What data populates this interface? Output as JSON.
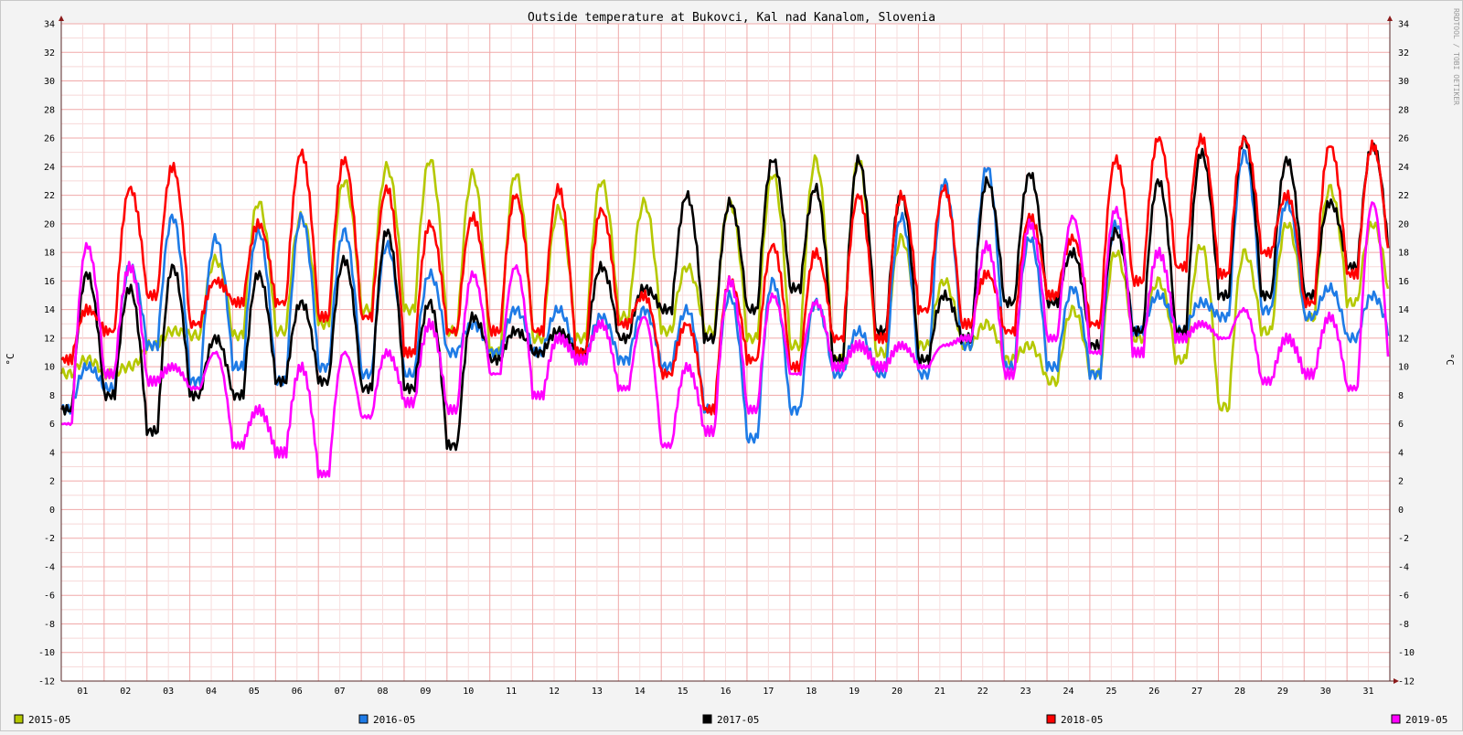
{
  "chart_data": {
    "type": "line",
    "title": "Outside temperature at Bukovci, Kal nad Kanalom, Slovenia",
    "ylabel": "°C",
    "ylabel_right": "°C",
    "watermark": "RRDTOOL / TOBI OETIKER",
    "ylim": [
      -12,
      34
    ],
    "y_ticks": [
      34,
      32,
      30,
      28,
      26,
      24,
      22,
      20,
      18,
      16,
      14,
      12,
      10,
      8,
      6,
      4,
      2,
      0,
      -2,
      -4,
      -6,
      -8,
      -10,
      -12
    ],
    "xlim": [
      1,
      32
    ],
    "x_ticks": [
      "01",
      "02",
      "03",
      "04",
      "05",
      "06",
      "07",
      "08",
      "09",
      "10",
      "11",
      "12",
      "13",
      "14",
      "15",
      "16",
      "17",
      "18",
      "19",
      "20",
      "21",
      "22",
      "23",
      "24",
      "25",
      "26",
      "27",
      "28",
      "29",
      "30",
      "31"
    ],
    "grid": true,
    "legend_position": "bottom",
    "series": [
      {
        "name": "2015-05",
        "color": "#b5c800",
        "min": [
          9.5,
          9.5,
          11.5,
          12.2,
          12.2,
          12.5,
          13.0,
          14.0,
          14.0,
          12.5,
          11.0,
          12.0,
          12.0,
          13.5,
          12.5,
          12.5,
          12.0,
          11.5,
          10.5,
          11.0,
          11.5,
          11.5,
          10.5,
          9.0,
          9.5,
          12.0,
          10.5,
          7.2,
          12.5,
          13.5,
          14.5
        ],
        "max": [
          10.5,
          10.0,
          12.5,
          17.5,
          21.5,
          20.5,
          23.0,
          24.0,
          24.5,
          23.5,
          23.5,
          21.0,
          23.0,
          21.5,
          17.0,
          21.5,
          23.5,
          24.5,
          24.5,
          19.0,
          16.0,
          13.0,
          11.5,
          14.0,
          18.0,
          16.0,
          18.5,
          18.0,
          20.0,
          22.5,
          20.0
        ]
      },
      {
        "name": "2016-05",
        "color": "#1e7be6",
        "min": [
          7.0,
          8.5,
          11.5,
          9.0,
          10.0,
          9.0,
          10.0,
          9.5,
          9.5,
          11.0,
          11.0,
          11.0,
          10.5,
          10.5,
          10.0,
          7.0,
          5.0,
          7.0,
          9.5,
          9.5,
          9.5,
          11.5,
          10.0,
          10.0,
          9.5,
          12.5,
          12.5,
          13.5,
          14.0,
          13.5,
          12.0
        ],
        "max": [
          10.0,
          17.0,
          20.5,
          19.0,
          19.5,
          20.5,
          19.5,
          18.5,
          16.5,
          13.0,
          14.0,
          14.0,
          13.5,
          14.0,
          14.0,
          15.0,
          16.0,
          14.5,
          12.5,
          20.5,
          23.0,
          24.0,
          19.0,
          15.5,
          20.0,
          15.0,
          14.5,
          25.0,
          21.5,
          15.5,
          15.0
        ]
      },
      {
        "name": "2017-05",
        "color": "#000000",
        "min": [
          7.0,
          8.0,
          5.5,
          8.0,
          8.0,
          9.0,
          9.0,
          8.5,
          8.5,
          4.5,
          10.5,
          11.0,
          11.0,
          12.0,
          14.0,
          12.0,
          14.0,
          15.5,
          10.5,
          12.5,
          10.5,
          12.0,
          14.5,
          14.5,
          11.5,
          12.5,
          12.5,
          15.0,
          15.0,
          15.0,
          17.0
        ],
        "max": [
          16.5,
          15.5,
          17.0,
          12.0,
          16.5,
          14.5,
          17.5,
          19.5,
          14.5,
          13.5,
          12.5,
          12.5,
          17.0,
          15.5,
          22.0,
          21.5,
          24.5,
          22.5,
          24.5,
          22.0,
          15.0,
          23.0,
          23.5,
          18.0,
          19.5,
          23.0,
          25.0,
          26.0,
          24.5,
          21.5,
          25.5
        ]
      },
      {
        "name": "2018-05",
        "color": "#ff0000",
        "min": [
          10.5,
          12.5,
          15.0,
          13.0,
          14.5,
          14.5,
          13.5,
          13.5,
          11.0,
          12.5,
          12.5,
          12.5,
          11.0,
          13.0,
          9.5,
          7.0,
          10.5,
          10.0,
          12.0,
          12.0,
          14.0,
          13.0,
          12.5,
          15.0,
          13.0,
          16.0,
          17.0,
          16.5,
          18.0,
          14.5,
          16.5
        ],
        "max": [
          14.0,
          22.5,
          24.0,
          16.0,
          20.0,
          25.0,
          24.5,
          22.5,
          20.0,
          20.5,
          22.0,
          22.5,
          21.0,
          15.0,
          13.0,
          16.0,
          18.5,
          18.0,
          22.0,
          22.0,
          22.5,
          16.5,
          20.5,
          19.0,
          24.5,
          26.0,
          26.0,
          26.0,
          22.0,
          25.5,
          25.5
        ]
      },
      {
        "name": "2019-05",
        "color": "#ff00ff",
        "min": [
          6.0,
          9.5,
          9.0,
          8.5,
          4.5,
          4.0,
          2.5,
          6.5,
          7.5,
          7.0,
          9.5,
          8.0,
          10.5,
          8.5,
          4.5,
          5.5,
          7.0,
          9.5,
          10.0,
          10.0,
          10.0,
          12.0,
          9.5,
          12.0,
          11.0,
          11.0,
          12.0,
          12.0,
          9.0,
          9.5,
          8.5
        ],
        "max": [
          18.5,
          17.0,
          10.0,
          11.0,
          7.0,
          10.0,
          11.0,
          11.0,
          13.0,
          16.5,
          17.0,
          12.0,
          13.0,
          13.5,
          10.0,
          16.0,
          15.0,
          14.5,
          11.5,
          11.5,
          11.5,
          18.5,
          20.0,
          20.5,
          21.0,
          18.0,
          13.0,
          14.0,
          12.0,
          13.5,
          21.5
        ]
      }
    ]
  }
}
